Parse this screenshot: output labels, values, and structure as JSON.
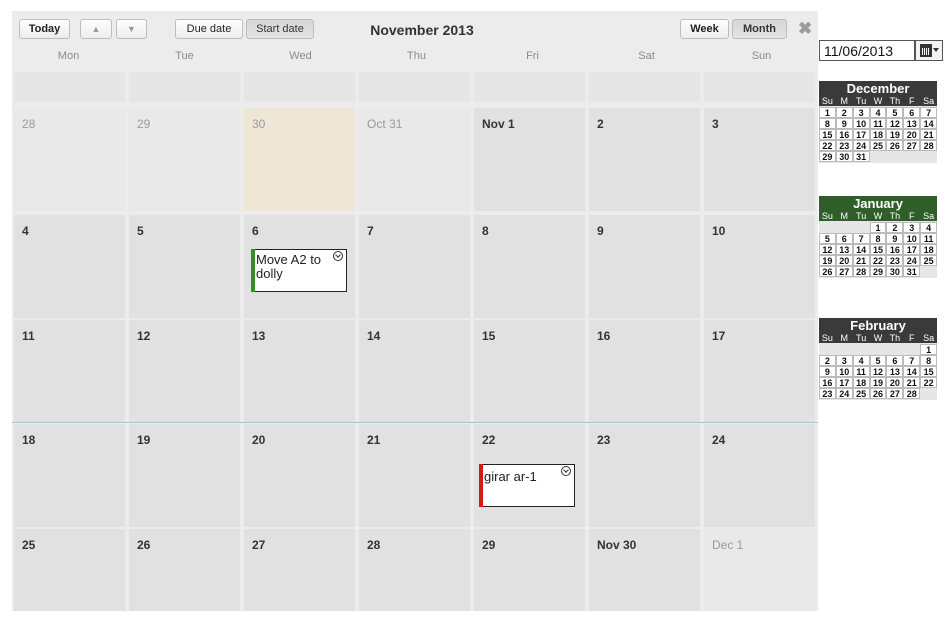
{
  "toolbar": {
    "today_label": "Today",
    "up_arrow": "▲",
    "down_arrow": "▼",
    "due_date_label": "Due date",
    "start_date_label": "Start date",
    "title": "November 2013",
    "week_label": "Week",
    "month_label": "Month",
    "close_glyph": "✖"
  },
  "weekdays": [
    "Mon",
    "Tue",
    "Wed",
    "Thu",
    "Fri",
    "Sat",
    "Sun"
  ],
  "weeks": [
    [
      "28",
      "29",
      "30",
      "Oct 31",
      "Nov 1",
      "2",
      "3"
    ],
    [
      "4",
      "5",
      "6",
      "7",
      "8",
      "9",
      "10"
    ],
    [
      "11",
      "12",
      "13",
      "14",
      "15",
      "16",
      "17"
    ],
    [
      "18",
      "19",
      "20",
      "21",
      "22",
      "23",
      "24"
    ],
    [
      "25",
      "26",
      "27",
      "28",
      "29",
      "Nov 30",
      "Dec 1"
    ]
  ],
  "events": [
    {
      "title": "Move A2 to dolly",
      "color": "#3c8a2e"
    },
    {
      "title": "girar ar-1",
      "color": "#d01c1c"
    }
  ],
  "date_input": {
    "value": "11/06/2013"
  },
  "mini_calendars": [
    {
      "name": "December",
      "header_color": "#3a3a3a",
      "dow": [
        "Su",
        "M",
        "Tu",
        "W",
        "Th",
        "F",
        "Sa"
      ],
      "rows": [
        [
          "1",
          "2",
          "3",
          "4",
          "5",
          "6",
          "7"
        ],
        [
          "8",
          "9",
          "10",
          "11",
          "12",
          "13",
          "14"
        ],
        [
          "15",
          "16",
          "17",
          "18",
          "19",
          "20",
          "21"
        ],
        [
          "22",
          "23",
          "24",
          "25",
          "26",
          "27",
          "28"
        ],
        [
          "29",
          "30",
          "31",
          "",
          "",
          "",
          ""
        ]
      ]
    },
    {
      "name": "January",
      "header_color": "#2f5e2a",
      "dow": [
        "Su",
        "M",
        "Tu",
        "W",
        "Th",
        "F",
        "Sa"
      ],
      "rows": [
        [
          "",
          "",
          "",
          "1",
          "2",
          "3",
          "4"
        ],
        [
          "5",
          "6",
          "7",
          "8",
          "9",
          "10",
          "11"
        ],
        [
          "12",
          "13",
          "14",
          "15",
          "16",
          "17",
          "18"
        ],
        [
          "19",
          "20",
          "21",
          "22",
          "23",
          "24",
          "25"
        ],
        [
          "26",
          "27",
          "28",
          "29",
          "30",
          "31",
          ""
        ]
      ]
    },
    {
      "name": "February",
      "header_color": "#3a3a3a",
      "dow": [
        "Su",
        "M",
        "Tu",
        "W",
        "Th",
        "F",
        "Sa"
      ],
      "rows": [
        [
          "",
          "",
          "",
          "",
          "",
          "",
          "1"
        ],
        [
          "2",
          "3",
          "4",
          "5",
          "6",
          "7",
          "8"
        ],
        [
          "9",
          "10",
          "11",
          "12",
          "13",
          "14",
          "15"
        ],
        [
          "16",
          "17",
          "18",
          "19",
          "20",
          "21",
          "22"
        ],
        [
          "23",
          "24",
          "25",
          "26",
          "27",
          "28",
          ""
        ]
      ]
    }
  ]
}
